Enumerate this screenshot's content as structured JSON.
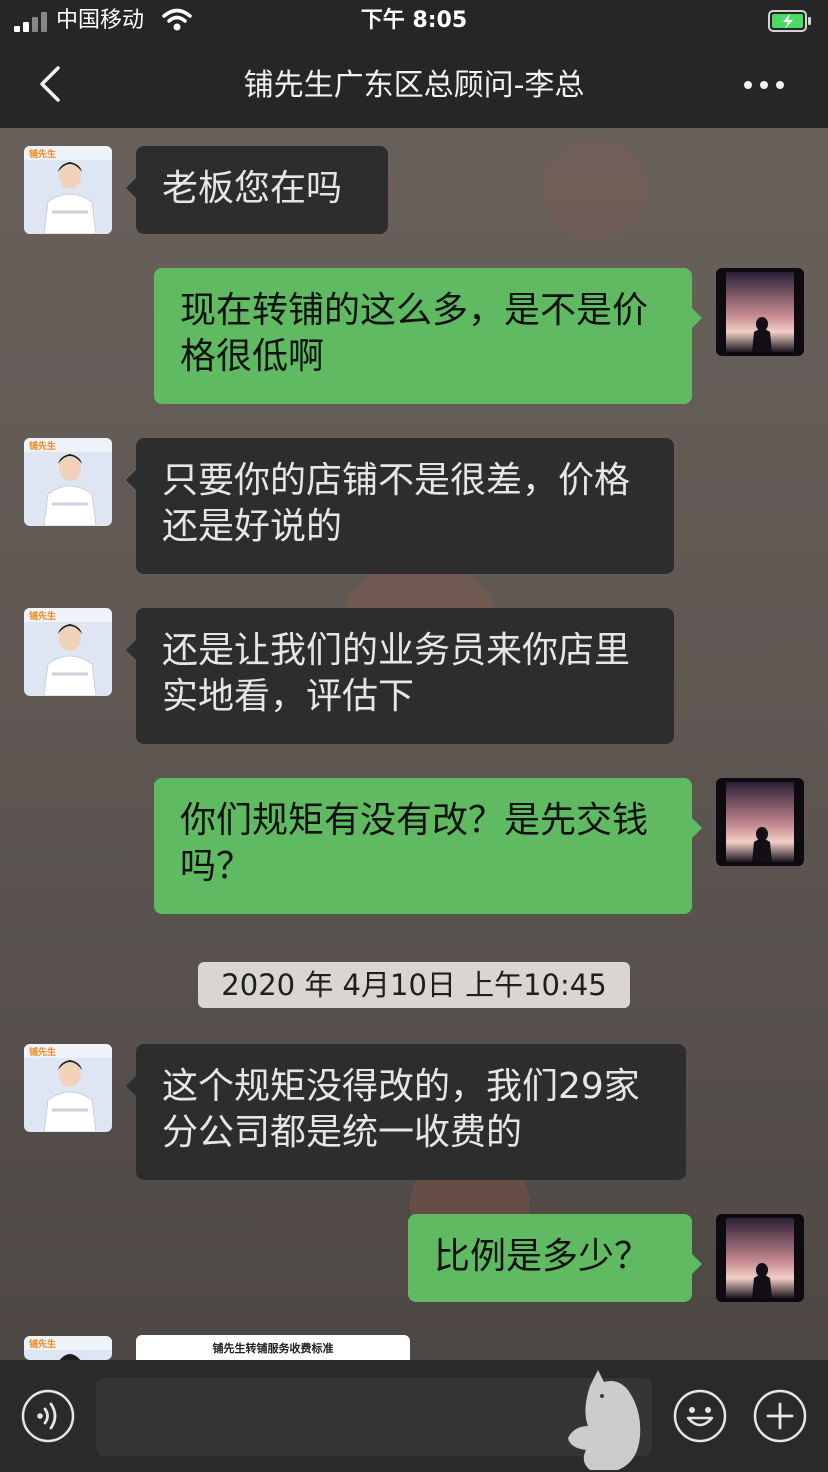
{
  "status_bar": {
    "carrier": "中国移动",
    "time": "下午 8:05",
    "signal_icon": "signal-bars-icon",
    "wifi_icon": "wifi-icon",
    "battery_icon": "battery-charging-icon",
    "battery_color": "#4cd964"
  },
  "nav": {
    "back_icon": "chevron-left-icon",
    "title": "铺先生广东区总顾问-李总",
    "more_icon": "more-dots-icon"
  },
  "colors": {
    "incoming_bubble": "#2d2d2d",
    "outgoing_bubble": "#5fba61",
    "bar_background": "#262626"
  },
  "messages": [
    {
      "sender": "contact",
      "text": "老板您在吗"
    },
    {
      "sender": "me",
      "text": "现在转铺的这么多，是不是价格很低啊"
    },
    {
      "sender": "contact",
      "text": "只要你的店铺不是很差，价格还是好说的"
    },
    {
      "sender": "contact",
      "text": "还是让我们的业务员来你店里实地看，评估下"
    },
    {
      "sender": "me",
      "text": "你们规矩有没有改？是先交钱吗？"
    },
    {
      "sender": "contact",
      "text": "这个规矩没得改的，我们29家分公司都是统一收费的"
    },
    {
      "sender": "me",
      "text": "比例是多少？"
    }
  ],
  "timestamp": "2020 年 4月10日 上午10:45",
  "contact_avatar": {
    "brand": "铺先生"
  },
  "image_card": {
    "title": "铺先生转铺服务收费标准"
  },
  "input_bar": {
    "voice_icon": "voice-icon",
    "text_value": "",
    "emoji_icon": "emoji-icon",
    "plus_icon": "plus-icon"
  }
}
